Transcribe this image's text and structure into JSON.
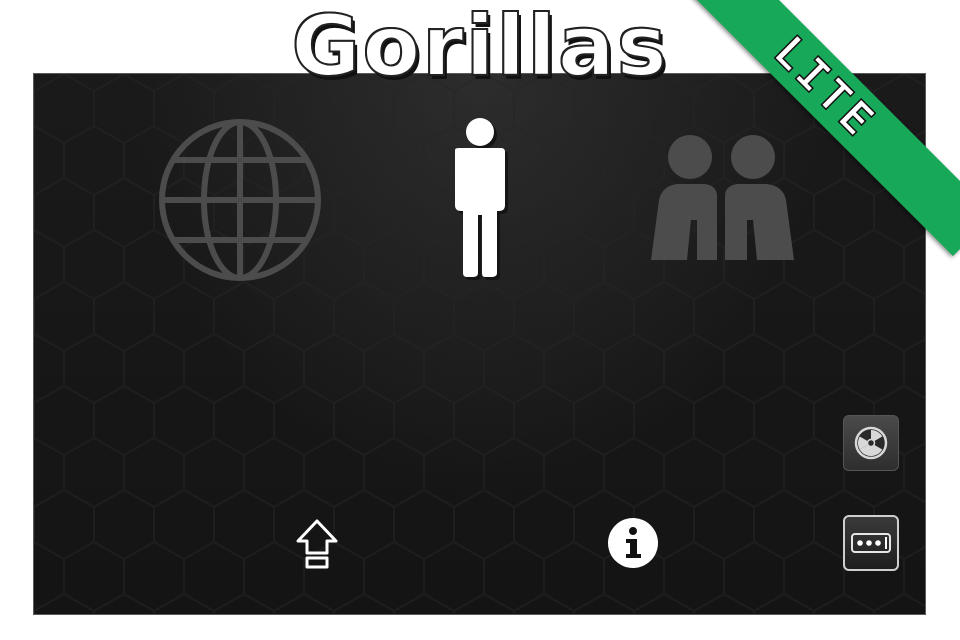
{
  "game": {
    "title": "Gorillas",
    "edition_banner": "LITE"
  },
  "modes": [
    {
      "name": "online-multiplayer",
      "icon": "globe-icon",
      "state": "dimmed"
    },
    {
      "name": "single-player",
      "icon": "single-person-icon",
      "state": "selected"
    },
    {
      "name": "multiplayer",
      "icon": "two-people-icon",
      "state": "dimmed"
    }
  ],
  "bottom_bar": {
    "upgrade_icon": "upgrade-arrow-icon",
    "info_icon": "info-icon",
    "nuke_icon": "radiation-icon",
    "menu_icon": "more-dots-icon"
  },
  "colors": {
    "banner": "#17a85a",
    "panel": "#161616",
    "dimmed_icon": "#4c4c4c",
    "selected_icon": "#ffffff"
  }
}
